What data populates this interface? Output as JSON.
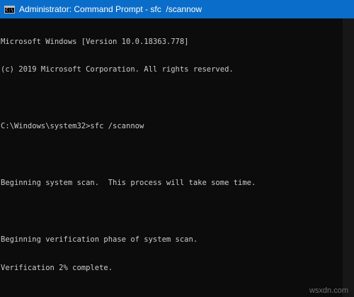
{
  "window": {
    "title": "Administrator: Command Prompt - sfc  /scannow",
    "icon": "cmd-icon",
    "title_bar_color": "#0a6dc9"
  },
  "console": {
    "text_color": "#cccccc",
    "background_color": "#0c0c0c",
    "lines": [
      "Microsoft Windows [Version 10.0.18363.778]",
      "(c) 2019 Microsoft Corporation. All rights reserved.",
      "",
      "C:\\Windows\\system32>sfc /scannow",
      "",
      "Beginning system scan.  This process will take some time.",
      "",
      "Beginning verification phase of system scan.",
      "Verification 2% complete."
    ]
  },
  "watermark": {
    "text": "wsxdn.com"
  }
}
